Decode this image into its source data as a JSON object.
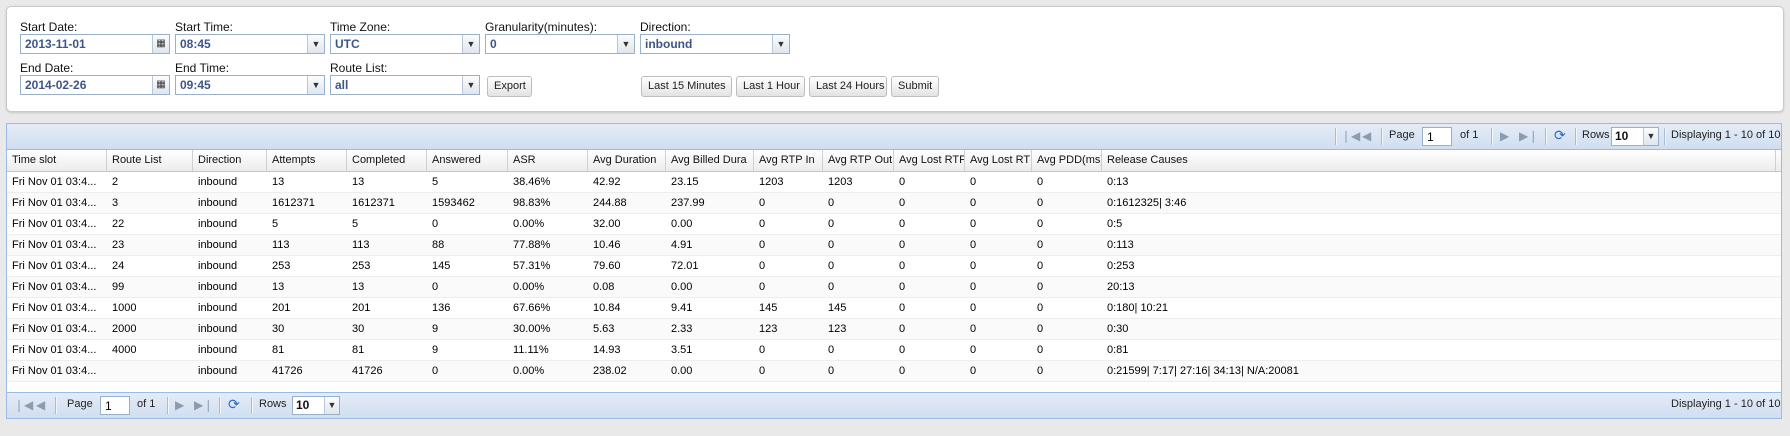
{
  "filters": {
    "start_date": {
      "label": "Start Date:",
      "value": "2013-11-01"
    },
    "start_time": {
      "label": "Start Time:",
      "value": "08:45"
    },
    "time_zone": {
      "label": "Time Zone:",
      "value": "UTC"
    },
    "granularity": {
      "label": "Granularity(minutes):",
      "value": "0"
    },
    "direction": {
      "label": "Direction:",
      "value": "inbound"
    },
    "end_date": {
      "label": "End Date:",
      "value": "2014-02-26"
    },
    "end_time": {
      "label": "End Time:",
      "value": "09:45"
    },
    "route_list": {
      "label": "Route List:",
      "value": "all"
    },
    "export_label": "Export",
    "last15_label": "Last 15 Minutes",
    "last1h_label": "Last 1 Hour",
    "last24h_label": "Last 24 Hours",
    "submit_label": "Submit"
  },
  "icons": {
    "calendar": "calendar-icon",
    "dropdown": "chevron-down-icon",
    "first": "first-page-icon",
    "prev": "prev-page-icon",
    "next": "next-page-icon",
    "last": "last-page-icon",
    "refresh": "refresh-icon"
  },
  "pager": {
    "page_label": "Page",
    "page_value": "1",
    "of_label": "of 1",
    "rows_label": "Rows",
    "rows_value": "10",
    "displaying": "Displaying 1 - 10 of 10"
  },
  "columns": [
    "Time slot",
    "Route List",
    "Direction",
    "Attempts",
    "Completed",
    "Answered",
    "ASR",
    "Avg Duration",
    "Avg Billed Dura",
    "Avg RTP In",
    "Avg RTP Out",
    "Avg Lost RTP",
    "Avg Lost RTP",
    "Avg PDD(ms)",
    "Release Causes"
  ],
  "rows": [
    [
      "Fri Nov 01 03:4...",
      "2",
      "inbound",
      "13",
      "13",
      "5",
      "38.46%",
      "42.92",
      "23.15",
      "1203",
      "1203",
      "0",
      "0",
      "0",
      "0:13"
    ],
    [
      "Fri Nov 01 03:4...",
      "3",
      "inbound",
      "1612371",
      "1612371",
      "1593462",
      "98.83%",
      "244.88",
      "237.99",
      "0",
      "0",
      "0",
      "0",
      "0",
      "0:1612325| 3:46"
    ],
    [
      "Fri Nov 01 03:4...",
      "22",
      "inbound",
      "5",
      "5",
      "0",
      "0.00%",
      "32.00",
      "0.00",
      "0",
      "0",
      "0",
      "0",
      "0",
      "0:5"
    ],
    [
      "Fri Nov 01 03:4...",
      "23",
      "inbound",
      "113",
      "113",
      "88",
      "77.88%",
      "10.46",
      "4.91",
      "0",
      "0",
      "0",
      "0",
      "0",
      "0:113"
    ],
    [
      "Fri Nov 01 03:4...",
      "24",
      "inbound",
      "253",
      "253",
      "145",
      "57.31%",
      "79.60",
      "72.01",
      "0",
      "0",
      "0",
      "0",
      "0",
      "0:253"
    ],
    [
      "Fri Nov 01 03:4...",
      "99",
      "inbound",
      "13",
      "13",
      "0",
      "0.00%",
      "0.08",
      "0.00",
      "0",
      "0",
      "0",
      "0",
      "0",
      "20:13"
    ],
    [
      "Fri Nov 01 03:4...",
      "1000",
      "inbound",
      "201",
      "201",
      "136",
      "67.66%",
      "10.84",
      "9.41",
      "145",
      "145",
      "0",
      "0",
      "0",
      "0:180| 10:21"
    ],
    [
      "Fri Nov 01 03:4...",
      "2000",
      "inbound",
      "30",
      "30",
      "9",
      "30.00%",
      "5.63",
      "2.33",
      "123",
      "123",
      "0",
      "0",
      "0",
      "0:30"
    ],
    [
      "Fri Nov 01 03:4...",
      "4000",
      "inbound",
      "81",
      "81",
      "9",
      "11.11%",
      "14.93",
      "3.51",
      "0",
      "0",
      "0",
      "0",
      "0",
      "0:81"
    ],
    [
      "Fri Nov 01 03:4...",
      "",
      "inbound",
      "41726",
      "41726",
      "0",
      "0.00%",
      "238.02",
      "0.00",
      "0",
      "0",
      "0",
      "0",
      "0",
      "0:21599| 7:17| 27:16| 34:13| N/A:20081"
    ]
  ]
}
